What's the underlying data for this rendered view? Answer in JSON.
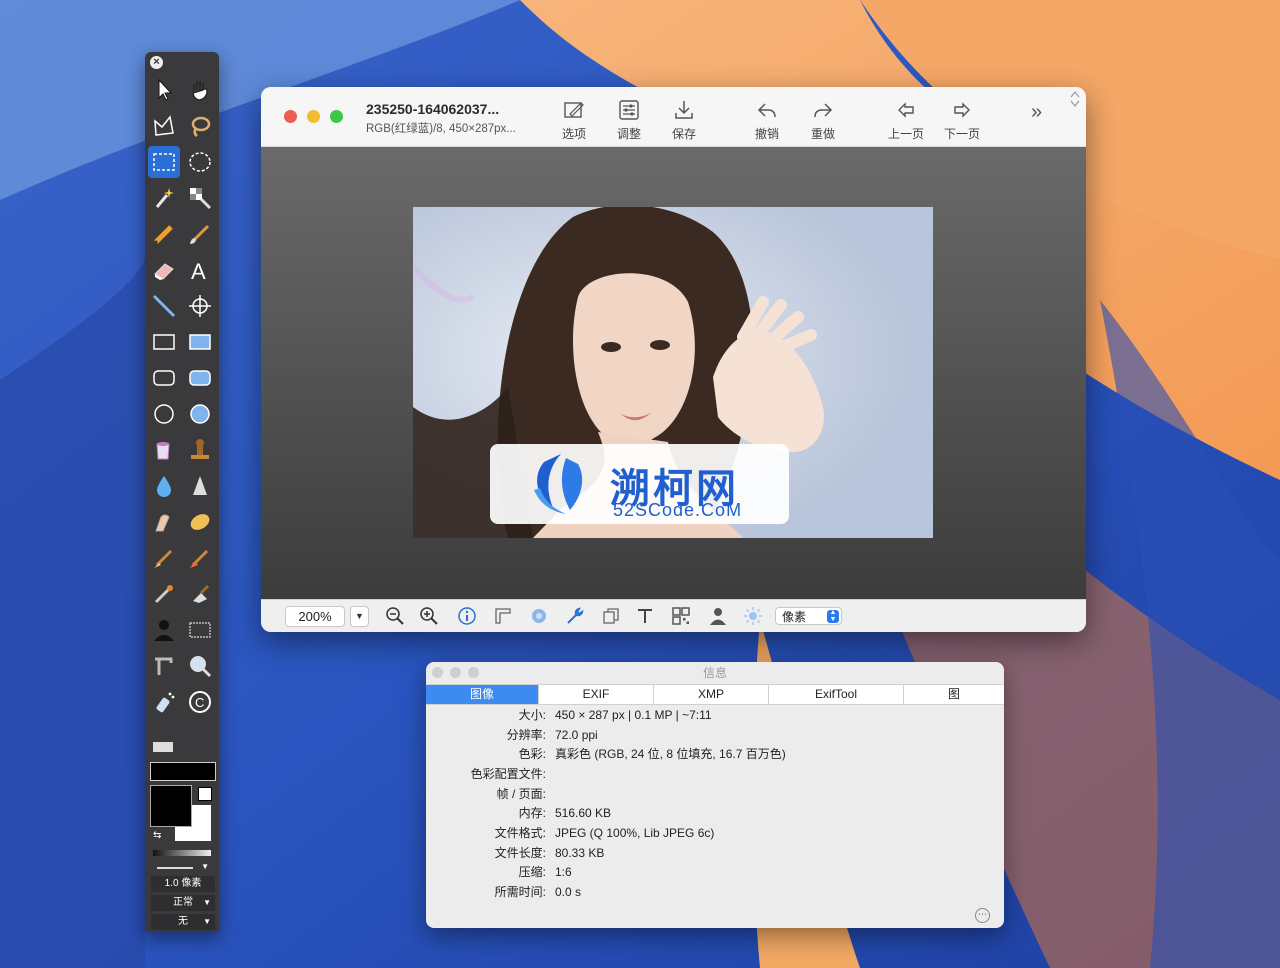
{
  "main_window": {
    "filename": "235250-164062037...",
    "file_info": "RGB(红绿蓝)/8, 450×287px...",
    "toolbar": [
      {
        "id": "options",
        "label": "选项",
        "icon": "options-icon"
      },
      {
        "id": "adjust",
        "label": "调整",
        "icon": "adjust-icon"
      },
      {
        "id": "save",
        "label": "保存",
        "icon": "save-icon"
      },
      {
        "id": "undo",
        "label": "撤销",
        "icon": "undo-icon"
      },
      {
        "id": "redo",
        "label": "重做",
        "icon": "redo-icon"
      },
      {
        "id": "prev",
        "label": "上一页",
        "icon": "arrow-left-icon"
      },
      {
        "id": "next",
        "label": "下一页",
        "icon": "arrow-right-icon"
      }
    ],
    "more_label": "»",
    "watermark": {
      "title": "溯柯网",
      "subtitle": "52SCode.CoM"
    },
    "statusbar": {
      "zoom": "200%",
      "unit": "像素"
    }
  },
  "palette": {
    "stroke_size": "1.0 像素",
    "blend_mode": "正常",
    "texture": "无"
  },
  "info_window": {
    "title": "信息",
    "tabs": [
      "图像",
      "EXIF",
      "XMP",
      "ExifTool",
      "图"
    ],
    "active_tab": "图像",
    "rows": [
      {
        "key": "大小:",
        "value": "450 × 287 px | 0.1 MP | ~7:11"
      },
      {
        "key": "分辨率:",
        "value": "72.0 ppi"
      },
      {
        "key": "色彩:",
        "value": "真彩色 (RGB, 24 位, 8 位填充, 16.7 百万色)"
      },
      {
        "key": "色彩配置文件:",
        "value": ""
      },
      {
        "key": "帧 / 页面:",
        "value": ""
      },
      {
        "key": "内存:",
        "value": "516.60 KB"
      },
      {
        "key": "文件格式:",
        "value": "JPEG (Q 100%, Lib JPEG 6c)"
      },
      {
        "key": "文件长度:",
        "value": "80.33 KB"
      },
      {
        "key": "压缩:",
        "value": "1:6"
      },
      {
        "key": "所需时间:",
        "value": "0.0 s"
      }
    ]
  },
  "colors": {
    "accent": "#2a6fd6",
    "tab_active": "#3d8bf0",
    "watermark": "#1f5fd0"
  }
}
